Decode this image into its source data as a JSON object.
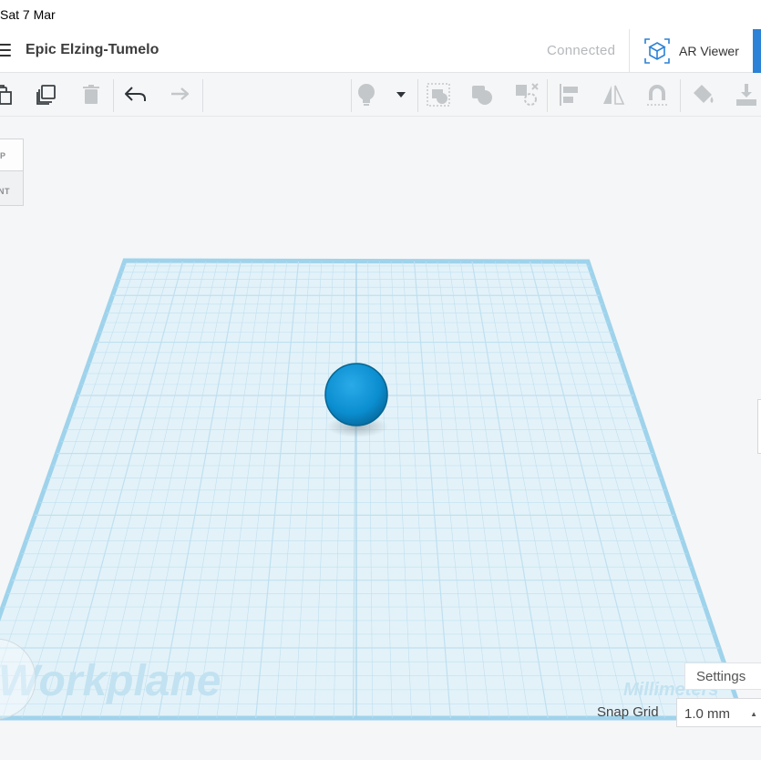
{
  "status_bar": {
    "date": "Sat 7 Mar"
  },
  "header": {
    "title": "Epic Elzing-Tumelo",
    "connection_status": "Connected",
    "ar_viewer_label": "AR Viewer",
    "accent_color": "#2b82d6"
  },
  "toolbar": {
    "icons": [
      "paste-icon",
      "duplicate-icon",
      "delete-icon",
      "undo-icon",
      "redo-icon",
      "show-all-icon",
      "lightbulb-dropdown-icon",
      "group-icon",
      "ungroup-icon",
      "hole-icon",
      "align-icon",
      "mirror-icon",
      "magnet-icon",
      "paint-icon",
      "import-icon"
    ]
  },
  "view_cube": {
    "top_label": "P",
    "front_label": "NT"
  },
  "workplane": {
    "watermark": "Workplane",
    "units_watermark": "Millimeters",
    "grid_color": "#bfe0f0",
    "plane_color": "#e3f2f9",
    "shape_color": "#0b8ed0"
  },
  "bottom_controls": {
    "settings_label": "Settings",
    "snap_grid_label": "Snap Grid",
    "snap_grid_value": "1.0 mm"
  }
}
